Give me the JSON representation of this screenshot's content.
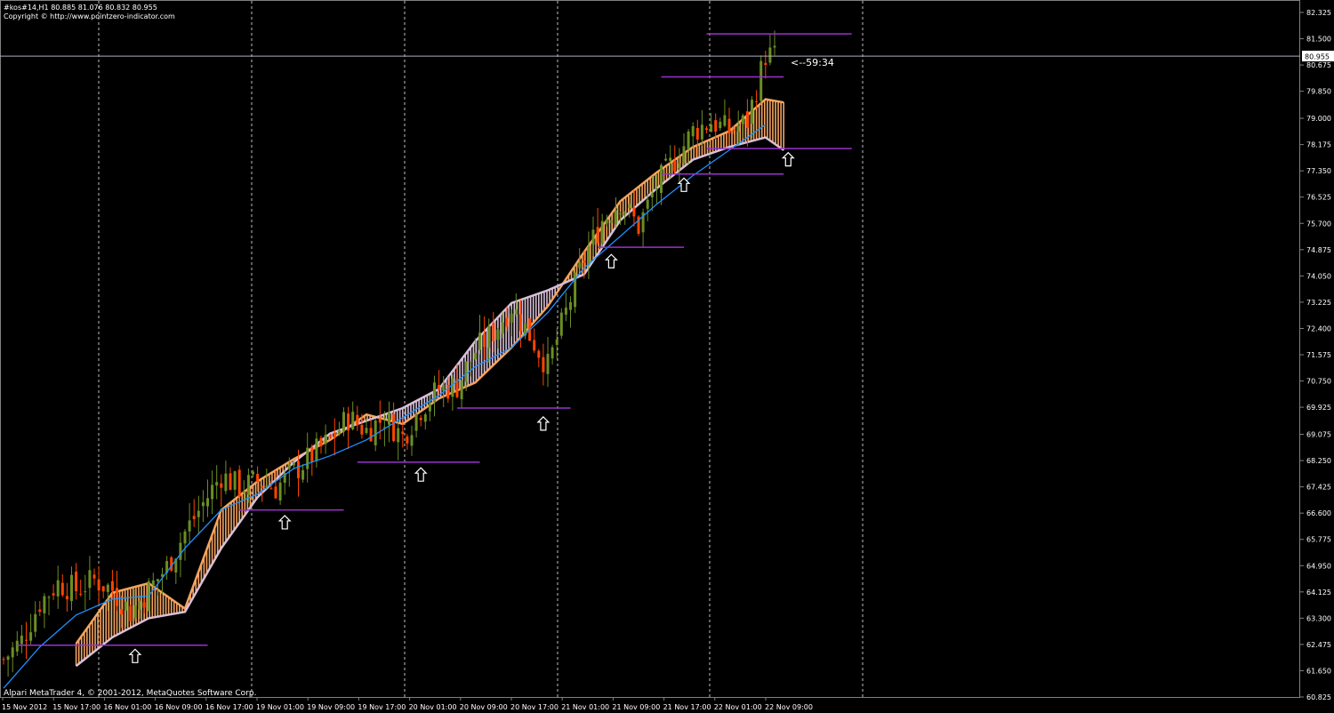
{
  "header": {
    "symbol_line": "#kos#14,H1  80.885 81.076 80.832 80.955",
    "copyright": "Copyright © http://www.pointzero-indicator.com"
  },
  "footer": {
    "text": "Alpari MetaTrader 4, © 2001-2012, MetaQuotes Software Corp."
  },
  "countdown": "<--59:34",
  "colors": {
    "background": "#000000",
    "bull": "#6b8e23",
    "bear": "#ff4500",
    "cloud_up": "#f4a460",
    "cloud_down": "#d8bfd8",
    "ma": "#1e90ff",
    "levels": "#9932cc",
    "axis_text": "#ffffff",
    "current_price": "#aab0c0"
  },
  "chart_data": {
    "type": "candlestick",
    "timeframe": "H1",
    "ylim": [
      60.825,
      82.325
    ],
    "y_ticks": [
      "82.325",
      "81.500",
      "80.675",
      "79.850",
      "79.000",
      "78.175",
      "77.350",
      "76.525",
      "75.700",
      "74.875",
      "74.050",
      "73.225",
      "72.400",
      "71.575",
      "70.750",
      "69.925",
      "69.075",
      "68.250",
      "67.425",
      "66.600",
      "65.775",
      "64.950",
      "64.125",
      "63.300",
      "62.475",
      "61.650",
      "60.825"
    ],
    "current_price": "80.955",
    "x_labels": [
      "15 Nov 2012",
      "15 Nov 17:00",
      "16 Nov 01:00",
      "16 Nov 09:00",
      "16 Nov 17:00",
      "19 Nov 01:00",
      "19 Nov 09:00",
      "19 Nov 17:00",
      "20 Nov 01:00",
      "20 Nov 09:00",
      "20 Nov 17:00",
      "21 Nov 01:00",
      "21 Nov 09:00",
      "21 Nov 17:00",
      "22 Nov 01:00",
      "22 Nov 09:00"
    ],
    "day_separators": [
      "16 Nov",
      "19 Nov",
      "20 Nov",
      "21 Nov",
      "22 Nov",
      "23 Nov"
    ],
    "candles_close_path": [
      [
        0,
        62.0
      ],
      [
        4,
        62.6
      ],
      [
        8,
        63.8
      ],
      [
        12,
        64.4
      ],
      [
        16,
        64.2
      ],
      [
        20,
        64.5
      ],
      [
        24,
        64.2
      ],
      [
        28,
        63.5
      ],
      [
        32,
        64.2
      ],
      [
        36,
        64.9
      ],
      [
        40,
        66.0
      ],
      [
        44,
        66.9
      ],
      [
        48,
        67.8
      ],
      [
        52,
        67.4
      ],
      [
        56,
        67.6
      ],
      [
        60,
        67.4
      ],
      [
        64,
        67.9
      ],
      [
        68,
        68.4
      ],
      [
        72,
        68.9
      ],
      [
        76,
        69.6
      ],
      [
        80,
        69.2
      ],
      [
        84,
        69.6
      ],
      [
        88,
        69.0
      ],
      [
        92,
        69.9
      ],
      [
        96,
        70.5
      ],
      [
        100,
        70.6
      ],
      [
        104,
        71.7
      ],
      [
        108,
        72.3
      ],
      [
        112,
        73.1
      ],
      [
        116,
        72.2
      ],
      [
        120,
        71.2
      ],
      [
        124,
        72.9
      ],
      [
        128,
        74.6
      ],
      [
        132,
        75.8
      ],
      [
        136,
        76.4
      ],
      [
        140,
        75.6
      ],
      [
        144,
        76.9
      ],
      [
        148,
        77.7
      ],
      [
        152,
        78.6
      ],
      [
        156,
        78.9
      ],
      [
        160,
        78.6
      ],
      [
        164,
        78.9
      ],
      [
        168,
        81.0
      ],
      [
        170,
        80.955
      ]
    ],
    "moving_average": [
      [
        0,
        61.1
      ],
      [
        8,
        62.4
      ],
      [
        16,
        63.4
      ],
      [
        24,
        63.9
      ],
      [
        32,
        64.0
      ],
      [
        40,
        65.5
      ],
      [
        48,
        66.7
      ],
      [
        56,
        67.2
      ],
      [
        64,
        68.0
      ],
      [
        72,
        68.4
      ],
      [
        80,
        68.9
      ],
      [
        88,
        69.6
      ],
      [
        96,
        70.3
      ],
      [
        104,
        71.2
      ],
      [
        112,
        71.8
      ],
      [
        120,
        72.9
      ],
      [
        128,
        74.3
      ],
      [
        136,
        75.3
      ],
      [
        144,
        76.3
      ],
      [
        152,
        77.2
      ],
      [
        160,
        78.0
      ],
      [
        168,
        78.8
      ]
    ],
    "ichimoku_cloud": {
      "span_a": [
        [
          16,
          62.5
        ],
        [
          24,
          64.1
        ],
        [
          32,
          64.4
        ],
        [
          40,
          63.6
        ],
        [
          48,
          66.7
        ],
        [
          56,
          67.6
        ],
        [
          64,
          68.3
        ],
        [
          72,
          68.9
        ],
        [
          80,
          69.7
        ],
        [
          88,
          69.4
        ],
        [
          96,
          70.2
        ],
        [
          104,
          70.7
        ],
        [
          112,
          71.8
        ],
        [
          120,
          73.1
        ],
        [
          128,
          74.8
        ],
        [
          136,
          76.4
        ],
        [
          144,
          77.3
        ],
        [
          152,
          78.1
        ],
        [
          160,
          78.6
        ],
        [
          168,
          79.6
        ],
        [
          172,
          79.5
        ]
      ],
      "span_b": [
        [
          16,
          61.8
        ],
        [
          24,
          62.7
        ],
        [
          32,
          63.3
        ],
        [
          40,
          63.5
        ],
        [
          48,
          65.5
        ],
        [
          56,
          67.1
        ],
        [
          64,
          68.2
        ],
        [
          72,
          69.1
        ],
        [
          80,
          69.5
        ],
        [
          88,
          69.9
        ],
        [
          96,
          70.5
        ],
        [
          104,
          72.0
        ],
        [
          112,
          73.2
        ],
        [
          120,
          73.6
        ],
        [
          128,
          74.1
        ],
        [
          136,
          75.8
        ],
        [
          144,
          76.8
        ],
        [
          152,
          77.7
        ],
        [
          160,
          78.1
        ],
        [
          168,
          78.4
        ],
        [
          172,
          78.0
        ]
      ]
    },
    "levels": [
      {
        "value": 62.45,
        "from": 3,
        "to": 45
      },
      {
        "value": 66.7,
        "from": 52,
        "to": 75
      },
      {
        "value": 68.2,
        "from": 78,
        "to": 105
      },
      {
        "value": 69.9,
        "from": 100,
        "to": 125
      },
      {
        "value": 74.95,
        "from": 131,
        "to": 150
      },
      {
        "value": 77.25,
        "from": 145,
        "to": 172
      },
      {
        "value": 78.05,
        "from": 155,
        "to": 187
      },
      {
        "value": 80.3,
        "from": 145,
        "to": 172
      },
      {
        "value": 81.65,
        "from": 155,
        "to": 187
      }
    ],
    "arrows": [
      {
        "at": 29,
        "value": 62.1
      },
      {
        "at": 62,
        "value": 66.3
      },
      {
        "at": 92,
        "value": 67.8
      },
      {
        "at": 119,
        "value": 69.4
      },
      {
        "at": 134,
        "value": 74.5
      },
      {
        "at": 150,
        "value": 76.9
      },
      {
        "at": 173,
        "value": 77.7
      }
    ]
  }
}
